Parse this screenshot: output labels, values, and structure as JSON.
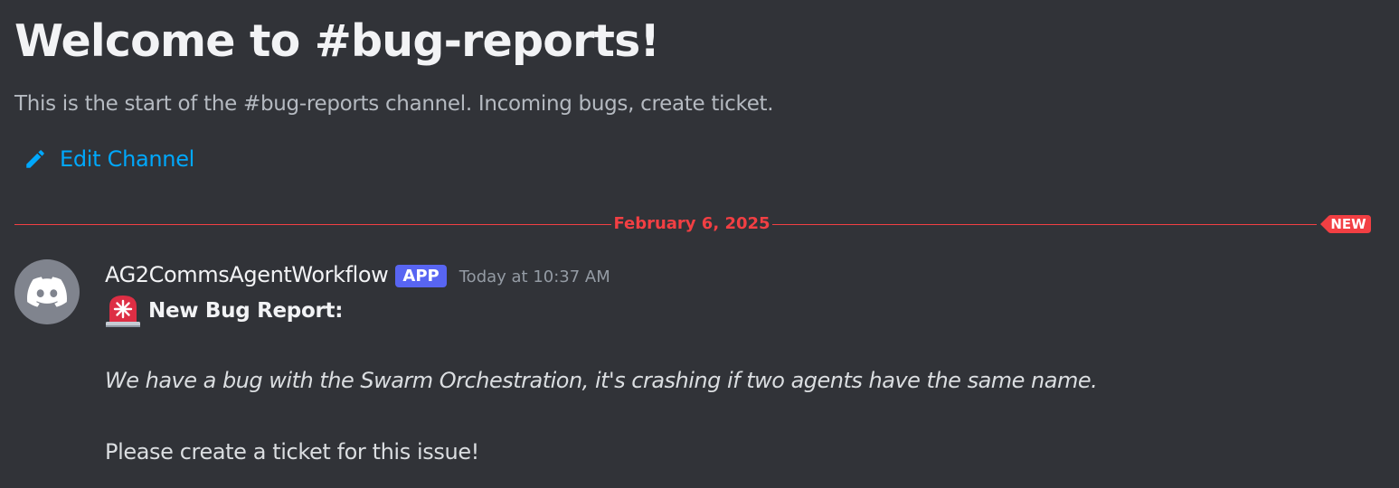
{
  "channel": {
    "welcome_title": "Welcome to #bug-reports!",
    "description": "This is the start of the #bug-reports channel. Incoming bugs, create ticket.",
    "edit_label": "Edit Channel"
  },
  "divider": {
    "date": "February 6, 2025",
    "new_label": "NEW"
  },
  "message": {
    "author": "AG2CommsAgentWorkflow",
    "badge": "APP",
    "timestamp": "Today at 10:37 AM",
    "emoji": "rotating-light-icon",
    "title": "New Bug Report:",
    "body_italic": "We have a bug with the Swarm Orchestration, it's crashing if two agents have the same name.",
    "body_plain": "Please create a ticket for this issue!"
  },
  "colors": {
    "background": "#313338",
    "link": "#00a8fc",
    "new_indicator": "#f23f43",
    "app_badge": "#5865f2",
    "avatar_bg": "#80848e"
  }
}
